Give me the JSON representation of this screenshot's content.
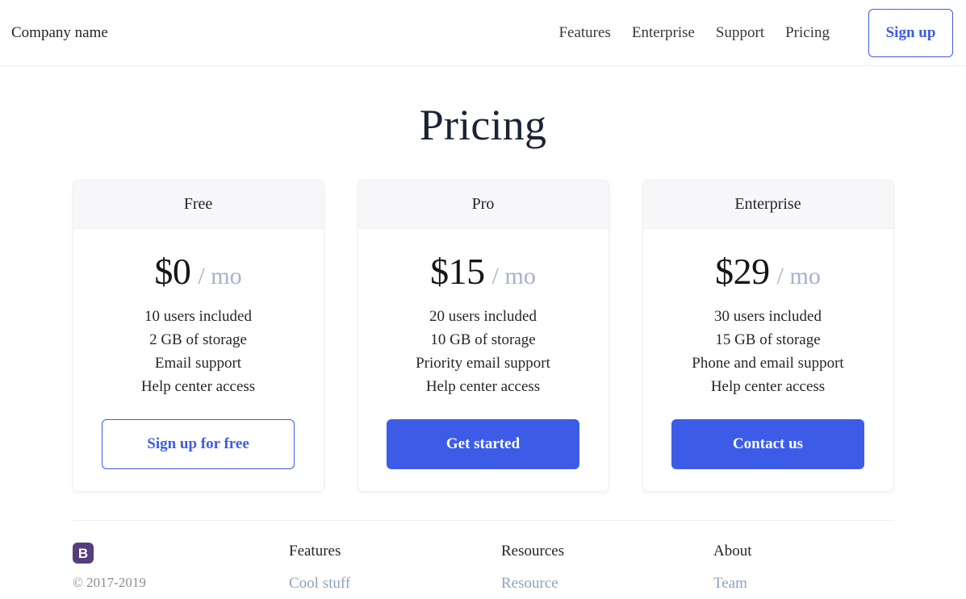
{
  "header": {
    "brand": "Company name",
    "nav_links": [
      {
        "label": "Features"
      },
      {
        "label": "Enterprise"
      },
      {
        "label": "Support"
      },
      {
        "label": "Pricing"
      }
    ],
    "signup_label": "Sign up"
  },
  "main": {
    "title": "Pricing",
    "plans": [
      {
        "name": "Free",
        "price": "$0",
        "period": "/ mo",
        "features": [
          "10 users included",
          "2 GB of storage",
          "Email support",
          "Help center access"
        ],
        "cta_label": "Sign up for free",
        "cta_style": "outline"
      },
      {
        "name": "Pro",
        "price": "$15",
        "period": "/ mo",
        "features": [
          "20 users included",
          "10 GB of storage",
          "Priority email support",
          "Help center access"
        ],
        "cta_label": "Get started",
        "cta_style": "primary"
      },
      {
        "name": "Enterprise",
        "price": "$29",
        "period": "/ mo",
        "features": [
          "30 users included",
          "15 GB of storage",
          "Phone and email support",
          "Help center access"
        ],
        "cta_label": "Contact us",
        "cta_style": "primary"
      }
    ]
  },
  "footer": {
    "logo_text": "B",
    "logo_name": "bootstrap-logo-icon",
    "copyright": "© 2017-2019",
    "columns": [
      {
        "title": "Features",
        "links": [
          "Cool stuff"
        ]
      },
      {
        "title": "Resources",
        "links": [
          "Resource"
        ]
      },
      {
        "title": "About",
        "links": [
          "Team"
        ]
      }
    ]
  },
  "colors": {
    "accent": "#3c5ce8",
    "logo_purple": "#563d7c",
    "muted": "#a5b2cc",
    "card_header_bg": "#f7f7f9"
  }
}
